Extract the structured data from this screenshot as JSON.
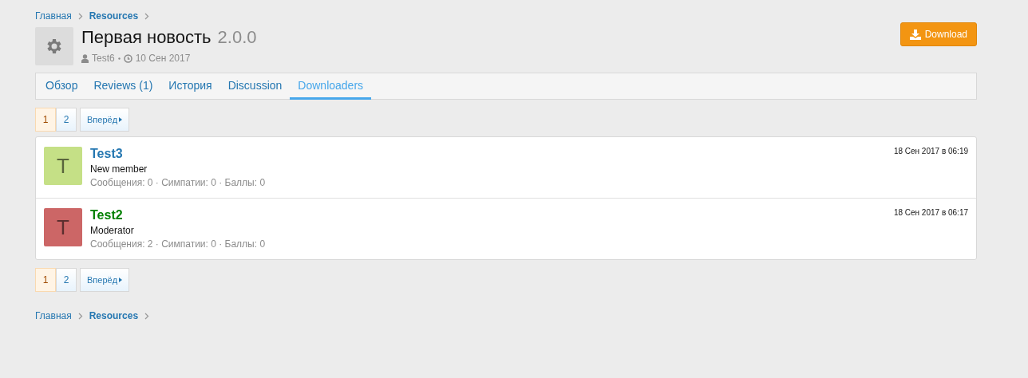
{
  "breadcrumb": [
    {
      "label": "Главная",
      "current": false
    },
    {
      "label": "Resources",
      "current": true
    }
  ],
  "resource": {
    "title": "Первая новость",
    "version": "2.0.0",
    "author": "Test6",
    "date": "10 Сен 2017"
  },
  "download_button": "Download",
  "tabs": [
    {
      "label": "Обзор",
      "selected": false
    },
    {
      "label": "Reviews (1)",
      "selected": false
    },
    {
      "label": "История",
      "selected": false
    },
    {
      "label": "Discussion",
      "selected": false
    },
    {
      "label": "Downloaders",
      "selected": true
    }
  ],
  "pagination_top": {
    "pages": [
      {
        "label": "1",
        "selected": true
      },
      {
        "label": "2",
        "selected": false
      }
    ],
    "next": "Вперёд"
  },
  "downloaders": [
    {
      "name": "Test3",
      "color": "#2577b1",
      "avatar": {
        "letter": "T",
        "color": "#c5e086"
      },
      "title": "New member",
      "stats": "Сообщения: 0 · Симпатии: 0 · Баллы: 0",
      "time": "18 Сен 2017 в 06:19"
    },
    {
      "name": "Test2",
      "color": "#008000",
      "avatar": {
        "letter": "T",
        "color": "#cc6666"
      },
      "title": "Moderator",
      "stats": "Сообщения: 2 · Симпатии: 0 · Баллы: 0",
      "time": "18 Сен 2017 в 06:17"
    }
  ],
  "pagination_bottom": {
    "pages": [
      {
        "label": "1",
        "selected": true
      },
      {
        "label": "2",
        "selected": false
      }
    ],
    "next": "Вперёд"
  },
  "footer_breadcrumb": [
    {
      "label": "Главная",
      "current": false
    },
    {
      "label": "Resources",
      "current": true
    }
  ]
}
